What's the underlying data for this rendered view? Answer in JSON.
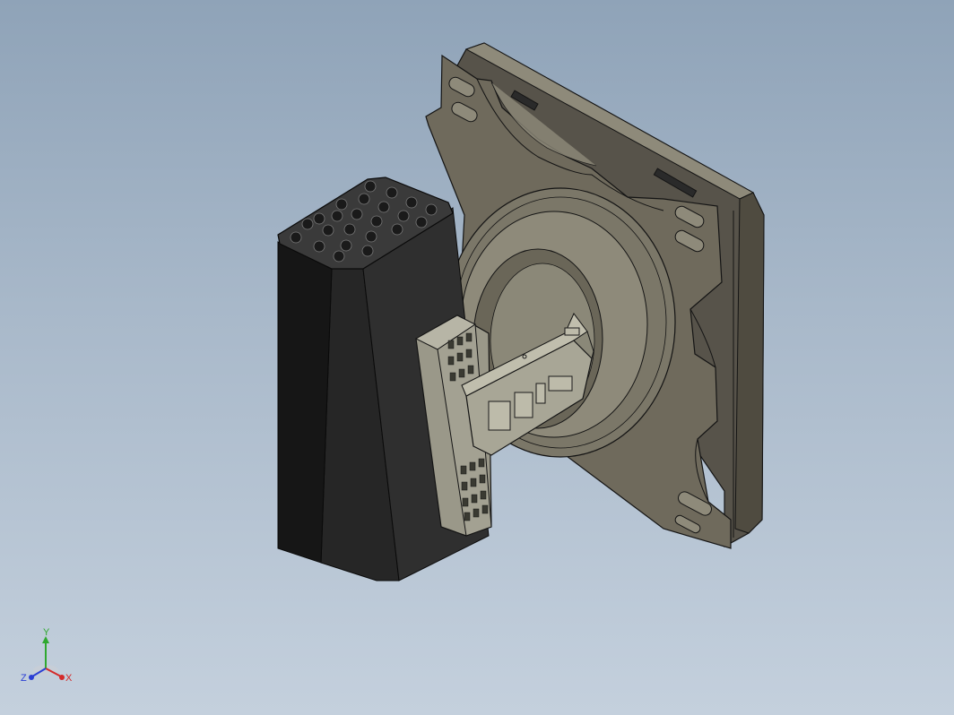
{
  "triad": {
    "x_label": "X",
    "y_label": "Y",
    "z_label": "Z",
    "x_color": "#d42a2a",
    "y_color": "#2fa82f",
    "z_color": "#2a3fd4"
  },
  "colors": {
    "background_top": "#8fa3b8",
    "background_bottom": "#c4d0dd",
    "plate": "#6f6a5c",
    "plate_light": "#8e8a7a",
    "plate_dark": "#4f4b40",
    "connector_body": "#1e1e1e",
    "connector_face": "#3a3a3a",
    "module": "#9a9889",
    "module_light": "#b7b5a6",
    "edge": "#141414"
  },
  "icons": [
    "cad-model",
    "view-triad-icon"
  ]
}
